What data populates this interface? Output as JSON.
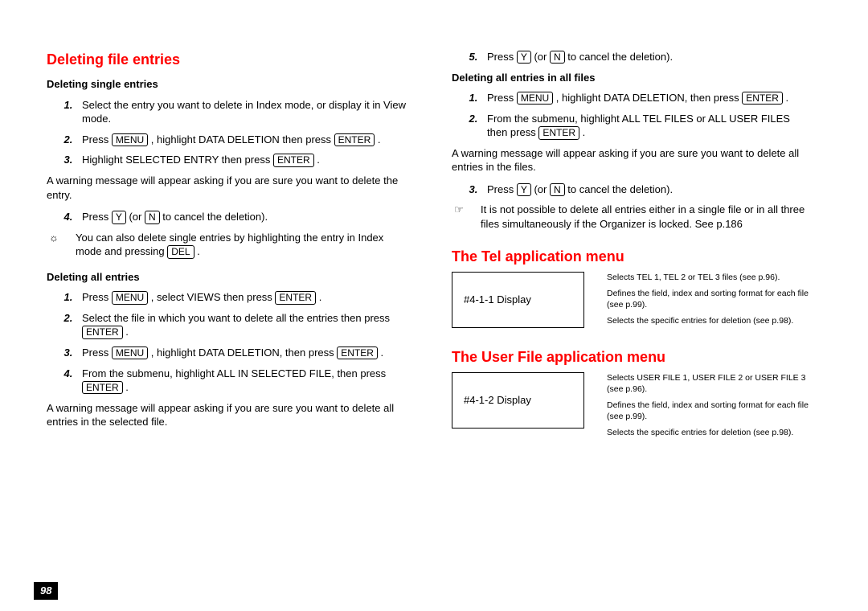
{
  "page_number": "98",
  "left": {
    "h_delete_file": "Deleting file entries",
    "h_single": "Deleting single entries",
    "single_step1": "Select the entry you want to delete in Index mode, or display it in View mode.",
    "single_step2a": "Press ",
    "single_step2b": " , highlight DATA DELETION then press ",
    "single_step2c": " .",
    "single_step3a": "Highlight SELECTED ENTRY then press ",
    "single_step3b": " .",
    "single_warn": "A warning message will appear asking if you are sure you want to delete the entry.",
    "single_step4a": "Press ",
    "single_step4b": " (or ",
    "single_step4c": " to cancel the deletion).",
    "tip_a": "You can also delete single entries by highlighting the entry in Index mode and pressing ",
    "tip_b": " .",
    "h_all": "Deleting all entries",
    "all_step1a": "Press ",
    "all_step1b": " , select VIEWS then press ",
    "all_step1c": " .",
    "all_step2a": "Select the file in which you want to delete all the entries then press ",
    "all_step2b": " .",
    "all_step3a": "Press ",
    "all_step3b": " , highlight DATA DELETION, then press ",
    "all_step3c": " .",
    "all_step4a": "From the submenu, highlight ALL IN SELECTED FILE, then press ",
    "all_step4b": " .",
    "all_warn": "A warning message will appear asking if you are sure you want to delete all entries in the selected file."
  },
  "right": {
    "top_step5a": "Press ",
    "top_step5b": " (or ",
    "top_step5c": " to cancel the deletion).",
    "h_allfiles": "Deleting all entries in all files",
    "af_step1a": "Press ",
    "af_step1b": " , highlight DATA DELETION, then press ",
    "af_step1c": " .",
    "af_step2a": "From the submenu, highlight ALL TEL FILES or ALL USER FILES then press ",
    "af_step2b": " .",
    "af_warn": "A warning message will appear asking if you are sure you want to delete all entries in the files.",
    "af_step3a": "Press ",
    "af_step3b": " (or ",
    "af_step3c": " to cancel the deletion).",
    "lock_note": "It is not possible to delete all entries either in a single file or in all three files simultaneously if the Organizer is locked. See p.186",
    "h_tel": "The Tel application menu",
    "tel_box": "#4-1-1 Display",
    "tel_desc1": "Selects TEL 1, TEL 2 or TEL 3 files (see p.96).",
    "tel_desc2": "Defines the field, index and sorting format for each file (see p.99).",
    "tel_desc3": "Selects the specific entries for deletion (see p.98).",
    "h_user": "The User File application menu",
    "user_box": "#4-1-2 Display",
    "user_desc1": "Selects USER FILE 1, USER FILE 2 or USER FILE 3 (see p.96).",
    "user_desc2": "Defines the field, index and sorting format for each file (see p.99).",
    "user_desc3": "Selects the specific entries for deletion (see p.98)."
  },
  "keys": {
    "menu": "MENU",
    "enter": "ENTER",
    "y": "Y",
    "n": "N",
    "del": "DEL"
  }
}
